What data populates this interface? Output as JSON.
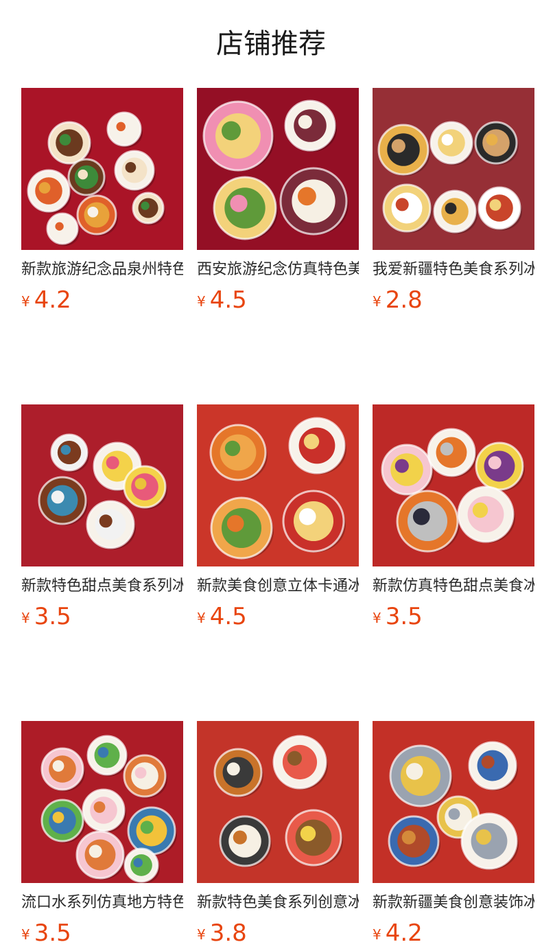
{
  "page": {
    "title": "店铺推荐"
  },
  "products": [
    {
      "name": "新款旅游纪念品泉州特色美食",
      "currency": "¥",
      "price": "4.2",
      "image": {
        "bg": "#b5162a",
        "icon": "food-plates-image"
      }
    },
    {
      "name": "西安旅游纪念仿真特色美食冰箱贴",
      "currency": "¥",
      "price": "4.5",
      "image": {
        "bg": "#9e1028",
        "icon": "food-plates-image"
      }
    },
    {
      "name": "我爱新疆特色美食系列冰箱贴",
      "currency": "¥",
      "price": "2.8",
      "image": {
        "bg": "#a0323a",
        "icon": "food-plates-image"
      }
    },
    {
      "name": "新款特色甜点美食系列冰箱贴",
      "currency": "¥",
      "price": "3.5",
      "image": {
        "bg": "#b8202e",
        "icon": "food-plates-image"
      }
    },
    {
      "name": "新款美食创意立体卡通冰箱贴",
      "currency": "¥",
      "price": "4.5",
      "image": {
        "bg": "#d83a2c",
        "icon": "food-plates-image"
      }
    },
    {
      "name": "新款仿真特色甜点美食冰箱贴",
      "currency": "¥",
      "price": "3.5",
      "image": {
        "bg": "#c92c2a",
        "icon": "food-plates-image"
      }
    },
    {
      "name": "流口水系列仿真地方特色美食",
      "currency": "¥",
      "price": "3.5",
      "image": {
        "bg": "#b81e2a",
        "icon": "food-plates-image"
      }
    },
    {
      "name": "新款特色美食系列创意冰箱贴",
      "currency": "¥",
      "price": "3.8",
      "image": {
        "bg": "#d0382c",
        "icon": "food-plates-image"
      }
    },
    {
      "name": "新款新疆美食创意装饰冰箱贴",
      "currency": "¥",
      "price": "4.2",
      "image": {
        "bg": "#d0342a",
        "icon": "food-plates-image"
      }
    }
  ]
}
